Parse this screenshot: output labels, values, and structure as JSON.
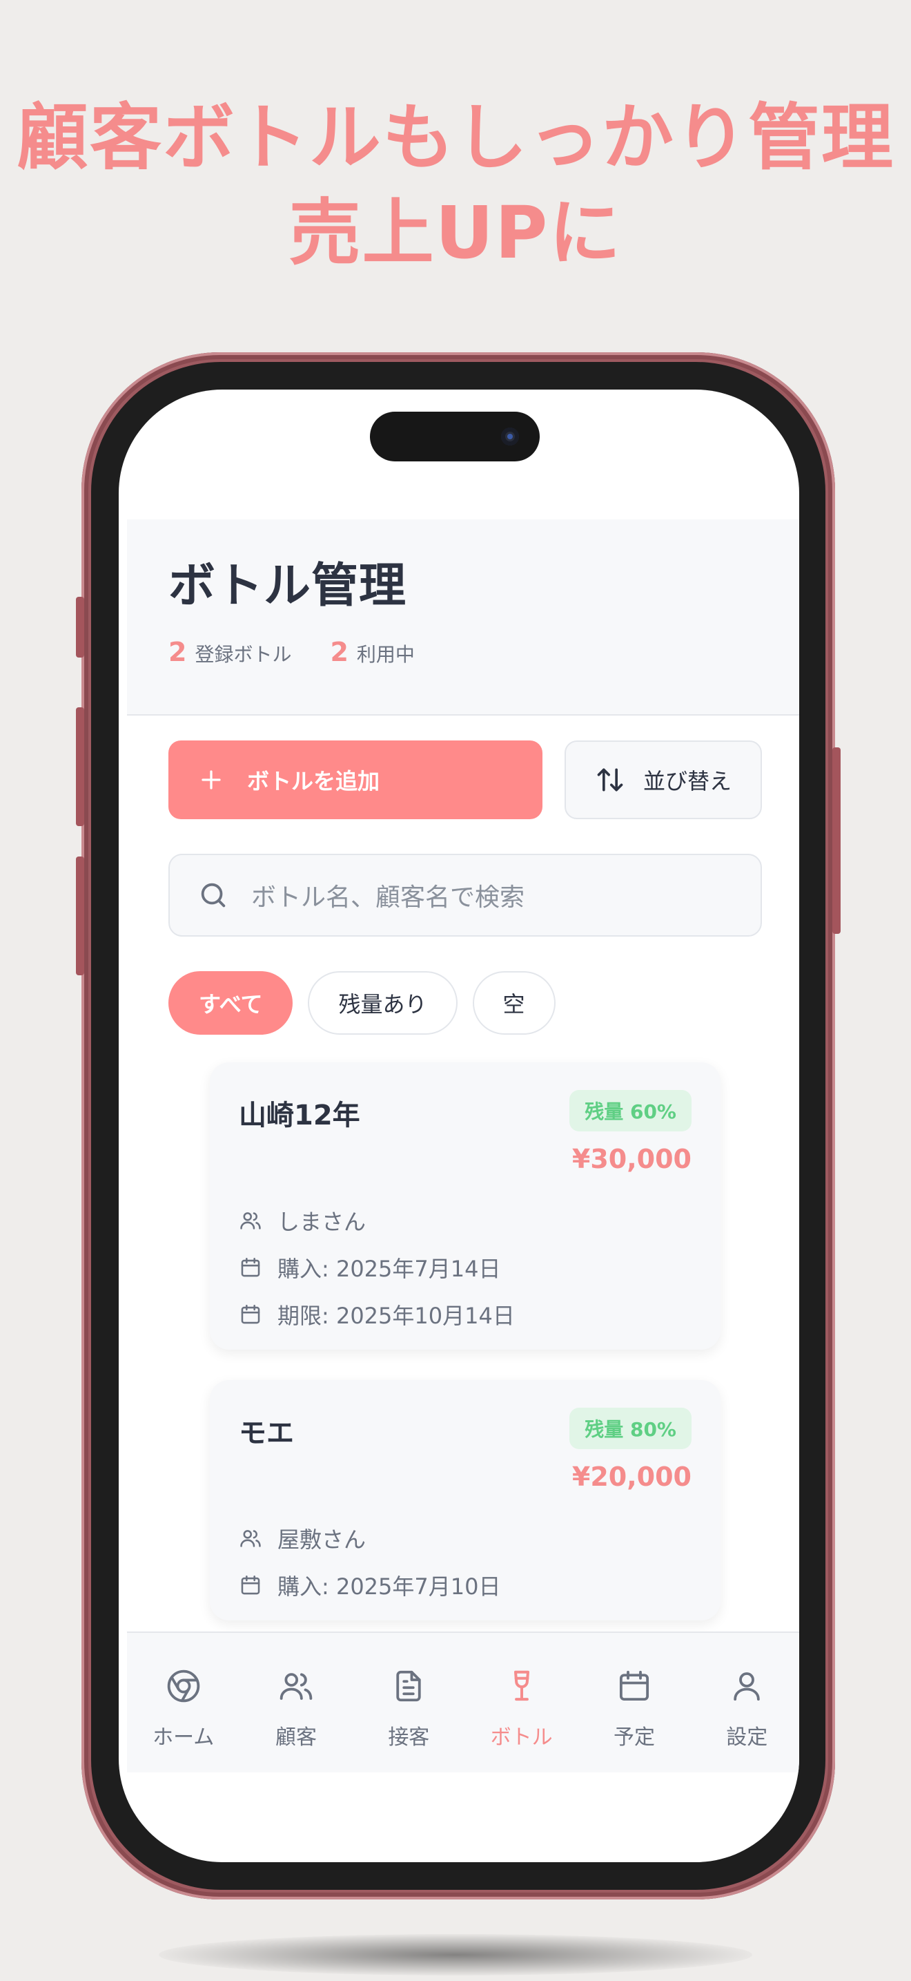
{
  "headline": {
    "line1": "顧客ボトルもしっかり管理",
    "line2": "売上UPに"
  },
  "app": {
    "title": "ボトル管理",
    "stats": [
      {
        "value": "2",
        "label": "登録ボトル"
      },
      {
        "value": "2",
        "label": "利用中"
      }
    ],
    "add_button": "ボトルを追加",
    "sort_button": "並び替え",
    "search_placeholder": "ボトル名、顧客名で検索",
    "filters": [
      "すべて",
      "残量あり",
      "空"
    ],
    "active_filter": "すべて",
    "bottles": [
      {
        "name": "山崎12年",
        "badge": "残量 60%",
        "price": "¥30,000",
        "customer": "しまさん",
        "purchase": "購入: 2025年7月14日",
        "expiry": "期限: 2025年10月14日"
      },
      {
        "name": "モエ",
        "badge": "残量 80%",
        "price": "¥20,000",
        "customer": "屋敷さん",
        "purchase": "購入: 2025年7月10日"
      }
    ],
    "tabs": [
      {
        "label": "ホーム",
        "icon": "chrome-icon"
      },
      {
        "label": "顧客",
        "icon": "users-icon"
      },
      {
        "label": "接客",
        "icon": "document-icon"
      },
      {
        "label": "ボトル",
        "icon": "wine-glass-icon"
      },
      {
        "label": "予定",
        "icon": "calendar-icon"
      },
      {
        "label": "設定",
        "icon": "user-icon"
      }
    ],
    "active_tab": "ボトル"
  },
  "colors": {
    "accent": "#ff8a8a",
    "accent_text": "#f58c8c",
    "badge_bg": "#e1f5e7",
    "badge_text": "#5fcf84",
    "frame": "#9e5a60",
    "background": "#efedeb"
  }
}
